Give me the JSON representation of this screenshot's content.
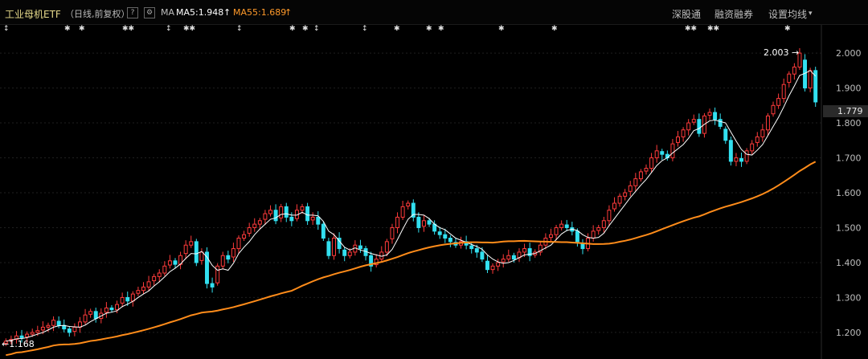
{
  "header": {
    "title": "工业母机ETF",
    "period": "（日线,前复权）",
    "help_glyph": "?",
    "ma_label": "MA",
    "ma5_text": "MA5:1.948",
    "ma55_text": "MA55:1.689",
    "shenguton": "深股通",
    "rongzi": "融资融券",
    "settings": "设置均线"
  },
  "colors": {
    "up": "#ff3b3b",
    "down": "#32e0f0",
    "ma5": "#ffffff",
    "ma55": "#ff8c1a",
    "grid": "#1f1f1f"
  },
  "chart_data": {
    "type": "candlestick",
    "ylim": [
      1.14,
      2.06
    ],
    "yticks": [
      "1.200",
      "1.300",
      "1.400",
      "1.500",
      "1.600",
      "1.700",
      "1.800",
      "1.900",
      "2.000"
    ],
    "current_price": "1.779",
    "high_label": "2.003",
    "low_label": "1.168",
    "ma5_latest": 1.948,
    "ma55_latest": 1.689,
    "closes": [
      1.175,
      1.18,
      1.19,
      1.185,
      1.195,
      1.2,
      1.205,
      1.215,
      1.22,
      1.235,
      1.22,
      1.21,
      1.2,
      1.215,
      1.23,
      1.25,
      1.26,
      1.24,
      1.255,
      1.27,
      1.265,
      1.28,
      1.3,
      1.29,
      1.31,
      1.32,
      1.33,
      1.345,
      1.36,
      1.37,
      1.39,
      1.405,
      1.395,
      1.42,
      1.45,
      1.46,
      1.4,
      1.43,
      1.34,
      1.33,
      1.39,
      1.42,
      1.41,
      1.44,
      1.47,
      1.48,
      1.5,
      1.51,
      1.52,
      1.54,
      1.55,
      1.52,
      1.56,
      1.53,
      1.52,
      1.55,
      1.56,
      1.52,
      1.53,
      1.51,
      1.47,
      1.42,
      1.47,
      1.44,
      1.42,
      1.43,
      1.45,
      1.44,
      1.42,
      1.39,
      1.41,
      1.43,
      1.46,
      1.5,
      1.53,
      1.56,
      1.57,
      1.53,
      1.5,
      1.52,
      1.51,
      1.49,
      1.48,
      1.47,
      1.46,
      1.45,
      1.46,
      1.45,
      1.44,
      1.43,
      1.41,
      1.38,
      1.39,
      1.4,
      1.41,
      1.42,
      1.41,
      1.43,
      1.44,
      1.42,
      1.43,
      1.45,
      1.47,
      1.48,
      1.5,
      1.51,
      1.5,
      1.49,
      1.46,
      1.44,
      1.47,
      1.49,
      1.5,
      1.52,
      1.55,
      1.57,
      1.59,
      1.6,
      1.62,
      1.64,
      1.66,
      1.67,
      1.7,
      1.72,
      1.71,
      1.7,
      1.74,
      1.76,
      1.78,
      1.8,
      1.81,
      1.77,
      1.82,
      1.83,
      1.81,
      1.79,
      1.75,
      1.69,
      1.7,
      1.69,
      1.72,
      1.74,
      1.76,
      1.78,
      1.82,
      1.85,
      1.87,
      1.91,
      1.94,
      1.96,
      2.0,
      1.9,
      1.95,
      1.86
    ],
    "marker_rows": [
      "↕",
      "✱ ✱",
      "✱✱",
      "↕ ✱✱",
      "↕",
      "✱ ✱ ↕",
      "↕ ✱",
      "✱ ✱",
      "✱",
      "✱",
      "✱✱ ✱✱",
      "✱"
    ]
  }
}
